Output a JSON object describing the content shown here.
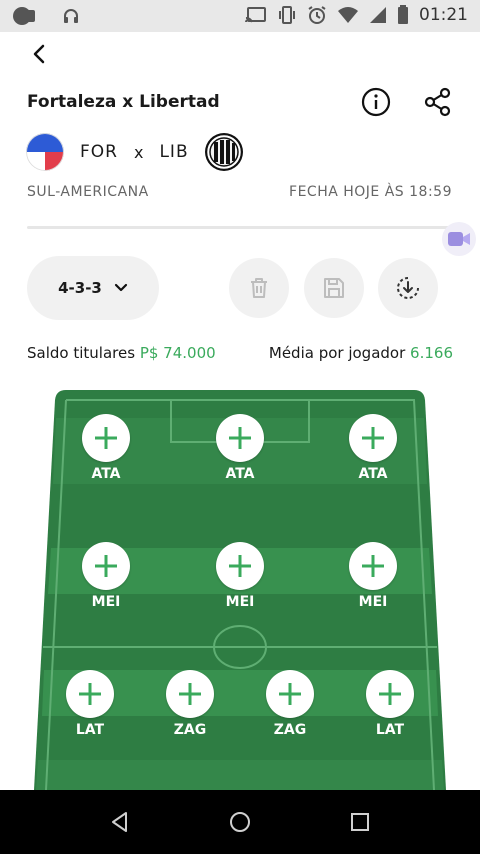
{
  "status_bar": {
    "time": "01:21"
  },
  "header": {
    "title": "Fortaleza x Libertad"
  },
  "match": {
    "home_abbr": "FOR",
    "vs": "x",
    "away_abbr": "LIB",
    "league": "SUL-AMERICANA",
    "closes": "FECHA HOJE ÀS 18:59"
  },
  "formation": {
    "value": "4-3-3"
  },
  "stats": {
    "balance_label": "Saldo titulares",
    "balance_value": "P$ 74.000",
    "avg_label": "Média por jogador",
    "avg_value": "6.166"
  },
  "pitch": {
    "forwards": [
      {
        "label": "ATA"
      },
      {
        "label": "ATA"
      },
      {
        "label": "ATA"
      }
    ],
    "midfielders": [
      {
        "label": "MEI"
      },
      {
        "label": "MEI"
      },
      {
        "label": "MEI"
      }
    ],
    "defenders": [
      {
        "label": "LAT"
      },
      {
        "label": "ZAG"
      },
      {
        "label": "ZAG"
      },
      {
        "label": "LAT"
      }
    ]
  },
  "colors": {
    "accent_green": "#3aaa5c",
    "pitch_dark": "#2e7d43",
    "pitch_light": "#38914f"
  }
}
